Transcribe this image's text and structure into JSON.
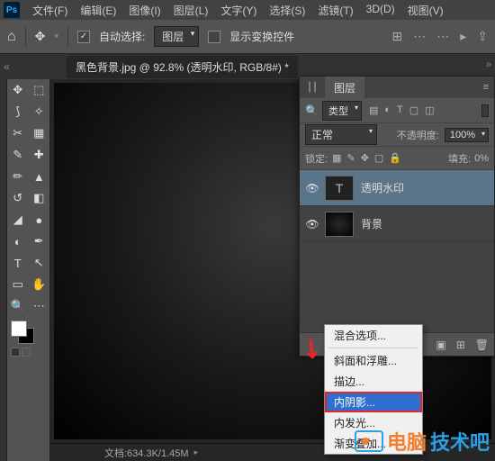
{
  "app": {
    "ps": "Ps"
  },
  "menu": {
    "file": "文件(F)",
    "edit": "编辑(E)",
    "image": "图像(I)",
    "layer": "图层(L)",
    "type": "文字(Y)",
    "select": "选择(S)",
    "filter": "滤镜(T)",
    "threeD": "3D(D)",
    "view": "视图(V)"
  },
  "options": {
    "auto_select": "自动选择:",
    "target": "图层",
    "show_transform": "显示变换控件"
  },
  "doc": {
    "tab": "黑色背景.jpg @ 92.8% (透明水印, RGB/8#) *"
  },
  "status": {
    "text": "文档:634.3K/1.45M"
  },
  "panel": {
    "tab": "图层",
    "kind": "类型",
    "blend": "正常",
    "opacity_lbl": "不透明度:",
    "opacity_val": "100%",
    "lock_lbl": "锁定:",
    "fill_lbl": "填充:",
    "fill_val": "0%"
  },
  "layers": [
    {
      "name": "透明水印",
      "thumb": "T"
    },
    {
      "name": "背景",
      "thumb": ""
    }
  ],
  "fx_menu": {
    "blend_opts": "混合选项...",
    "bevel": "斜面和浮雕...",
    "stroke": "描边...",
    "inner_shadow": "内阴影...",
    "inner_glow": "内发光...",
    "gradient": "渐变叠加..."
  },
  "watermark": {
    "t1": "电脑",
    "t2": "技术吧"
  }
}
